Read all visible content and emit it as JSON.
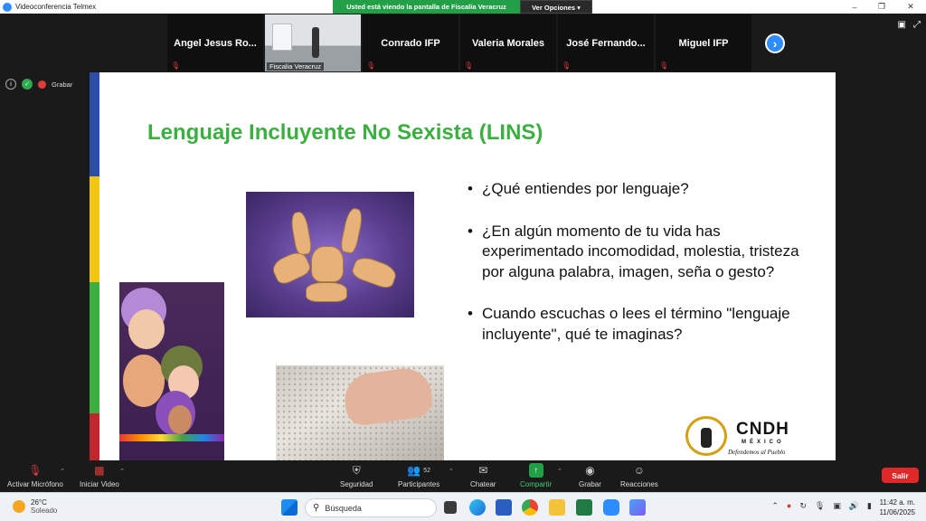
{
  "window": {
    "title": "Videoconferencia Telmex"
  },
  "share_banner": {
    "message": "Usted está viendo la pantalla de Fiscalía Veracruz",
    "options_label": "Ver Opciones"
  },
  "participants": [
    {
      "name": "Angel Jesus Ro...",
      "video": false
    },
    {
      "name": "Fiscalia Veracruz",
      "video": true
    },
    {
      "name": "Conrado IFP",
      "video": false
    },
    {
      "name": "Valeria Morales",
      "video": false
    },
    {
      "name": "José Fernando...",
      "video": false
    },
    {
      "name": "Miguel IFP",
      "video": false
    }
  ],
  "status": {
    "record_label": "Grabar"
  },
  "slide": {
    "title": "Lenguaje Incluyente No Sexista (LINS)",
    "bullets": [
      "¿Qué entiendes por lenguaje?",
      "¿En algún momento de tu vida has experimentado incomodidad, molestia, tristeza por alguna palabra, imagen, seña o gesto?",
      "Cuando escuchas o lees el término \"lenguaje incluyente\", qué te imaginas?"
    ],
    "logo": {
      "brand": "CNDH",
      "country": "MÉXICO",
      "motto": "Defendemos al Pueblo"
    },
    "colors": {
      "title": "#3bb041",
      "bar_blue": "#2b4fa8",
      "bar_yellow": "#f3c614",
      "bar_green": "#3bb041",
      "bar_red": "#c0262d"
    }
  },
  "toolbar": {
    "mic_label": "Activar Micrófono",
    "video_label": "Iniciar Video",
    "security_label": "Seguridad",
    "participants_label": "Participantes",
    "participants_count": "52",
    "chat_label": "Chatear",
    "share_label": "Compartir",
    "record_label": "Grabar",
    "reactions_label": "Reacciones",
    "leave_label": "Salir"
  },
  "taskbar": {
    "weather_temp": "26°C",
    "weather_desc": "Soleado",
    "search_placeholder": "Búsqueda",
    "time": "11:42 a. m.",
    "date": "11/06/2025"
  }
}
